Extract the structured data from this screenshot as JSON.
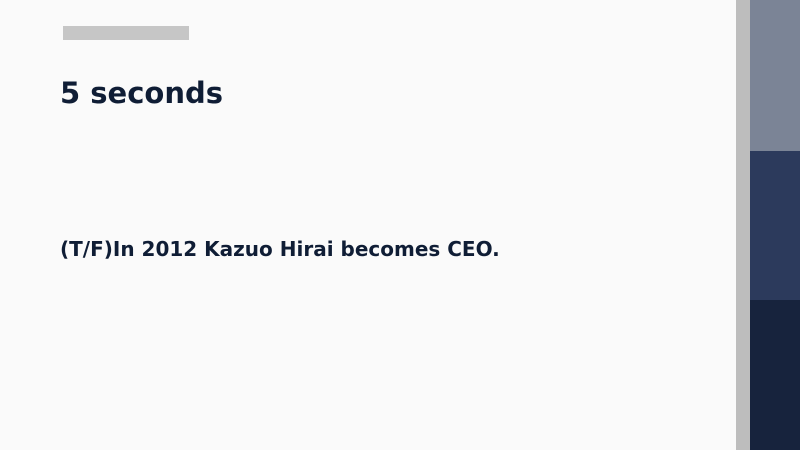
{
  "slide": {
    "title": "5 seconds",
    "question": "(T/F)In 2012 Kazuo Hirai becomes CEO."
  },
  "theme": {
    "background": "#fafafa",
    "accent_bar": "#c6c6c6",
    "side_stripe": "#bdbdbd",
    "side_blocks": [
      "#7b8496",
      "#2c3a5c",
      "#17233d"
    ],
    "text": "#0f1d35"
  }
}
